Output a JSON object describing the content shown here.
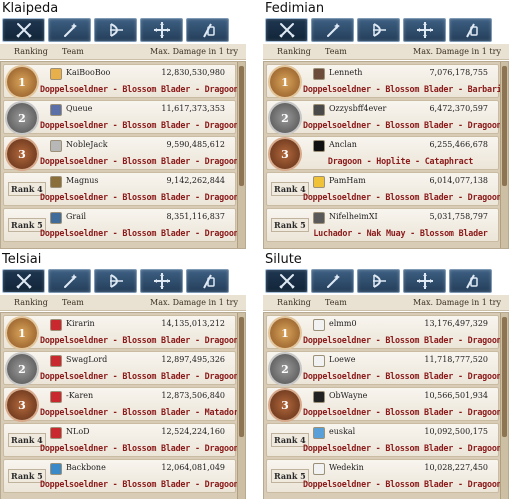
{
  "columns": {
    "ranking": "Ranking",
    "team": "Team",
    "damage": "Max. Damage in 1 try"
  },
  "panels": [
    {
      "region": "Klaipeda",
      "rows": [
        {
          "rank": "1",
          "name": "KaiBooBoo",
          "damage": "12,830,530,980",
          "class": "Doppelsoeldner - Blossom Blader - Dragoon",
          "avatar_color": "#e8b04a"
        },
        {
          "rank": "2",
          "name": "Queue",
          "damage": "11,617,373,353",
          "class": "Doppelsoeldner - Blossom Blader - Dragoon",
          "avatar_color": "#5b6fa8"
        },
        {
          "rank": "3",
          "name": "NobleJack",
          "damage": "9,590,485,612",
          "class": "Doppelsoeldner - Blossom Blader - Dragoon",
          "avatar_color": "#b7b7b7"
        },
        {
          "rank": "Rank 4",
          "name": "Magnus",
          "damage": "9,142,262,844",
          "class": "Doppelsoeldner - Blossom Blader - Dragoon",
          "avatar_color": "#8a6f3a"
        },
        {
          "rank": "Rank 5",
          "name": "Grail",
          "damage": "8,351,116,837",
          "class": "Doppelsoeldner - Blossom Blader - Dragoon",
          "avatar_color": "#3f6c9a"
        }
      ]
    },
    {
      "region": "Fedimian",
      "rows": [
        {
          "rank": "1",
          "name": "Lenneth",
          "damage": "7,076,178,755",
          "class": "Doppelsoeldner - Blossom Blader - Barbarian",
          "avatar_color": "#6b4c3b"
        },
        {
          "rank": "2",
          "name": "Ozzysbff4ever",
          "damage": "6,472,370,597",
          "class": "Doppelsoeldner - Blossom Blader - Dragoon",
          "avatar_color": "#4a4a4a"
        },
        {
          "rank": "3",
          "name": "Anclan",
          "damage": "6,255,466,678",
          "class": "Dragoon - Hoplite - Cataphract",
          "avatar_color": "#111111"
        },
        {
          "rank": "Rank 4",
          "name": "PamHam",
          "damage": "6,014,077,138",
          "class": "Doppelsoeldner - Blossom Blader - Dragoon",
          "avatar_color": "#f0c23a"
        },
        {
          "rank": "Rank 5",
          "name": "NifelheimXI",
          "damage": "5,031,758,797",
          "class": "Luchador - Nak Muay - Blossom Blader",
          "avatar_color": "#5a5a5a"
        }
      ]
    },
    {
      "region": "Telsiai",
      "rows": [
        {
          "rank": "1",
          "name": "Kirarin",
          "damage": "14,135,013,212",
          "class": "Doppelsoeldner - Blossom Blader - Dragoon",
          "avatar_color": "#c8282e"
        },
        {
          "rank": "2",
          "name": "SwagLord",
          "damage": "12,897,495,326",
          "class": "Doppelsoeldner - Blossom Blader - Dragoon",
          "avatar_color": "#c8282e"
        },
        {
          "rank": "3",
          "name": "-Karen",
          "damage": "12,873,506,840",
          "class": "Doppelsoeldner - Blossom Blader - Matador",
          "avatar_color": "#c8282e"
        },
        {
          "rank": "Rank 4",
          "name": "NLoD",
          "damage": "12,524,224,160",
          "class": "Doppelsoeldner - Blossom Blader - Dragoon",
          "avatar_color": "#c8282e"
        },
        {
          "rank": "Rank 5",
          "name": "Backbone",
          "damage": "12,064,081,049",
          "class": "Doppelsoeldner - Blossom Blader - Dragoon",
          "avatar_color": "#3a89c9"
        }
      ]
    },
    {
      "region": "Silute",
      "rows": [
        {
          "rank": "1",
          "name": "elmm0",
          "damage": "13,176,497,329",
          "class": "Doppelsoeldner - Blossom Blader - Dragoon",
          "avatar_color": "#f2f2f2"
        },
        {
          "rank": "2",
          "name": "Loewe",
          "damage": "11,718,777,520",
          "class": "Doppelsoeldner - Blossom Blader - Dragoon",
          "avatar_color": "#f2f2f2"
        },
        {
          "rank": "3",
          "name": "ObWayne",
          "damage": "10,566,501,934",
          "class": "Doppelsoeldner - Blossom Blader - Dragoon",
          "avatar_color": "#222222"
        },
        {
          "rank": "Rank 4",
          "name": "euskal",
          "damage": "10,092,500,175",
          "class": "Doppelsoeldner - Blossom Blader - Dragoon",
          "avatar_color": "#5aa0d8"
        },
        {
          "rank": "Rank 5",
          "name": "Wedekin",
          "damage": "10,028,227,450",
          "class": "Doppelsoeldner - Blossom Blader - Dragoon",
          "avatar_color": "#f2f2f2"
        }
      ]
    }
  ],
  "tabs": [
    {
      "icon": "crossed-swords-icon"
    },
    {
      "icon": "wand-icon"
    },
    {
      "icon": "bow-icon"
    },
    {
      "icon": "crosshair-icon"
    },
    {
      "icon": "scroll-staff-icon"
    }
  ]
}
